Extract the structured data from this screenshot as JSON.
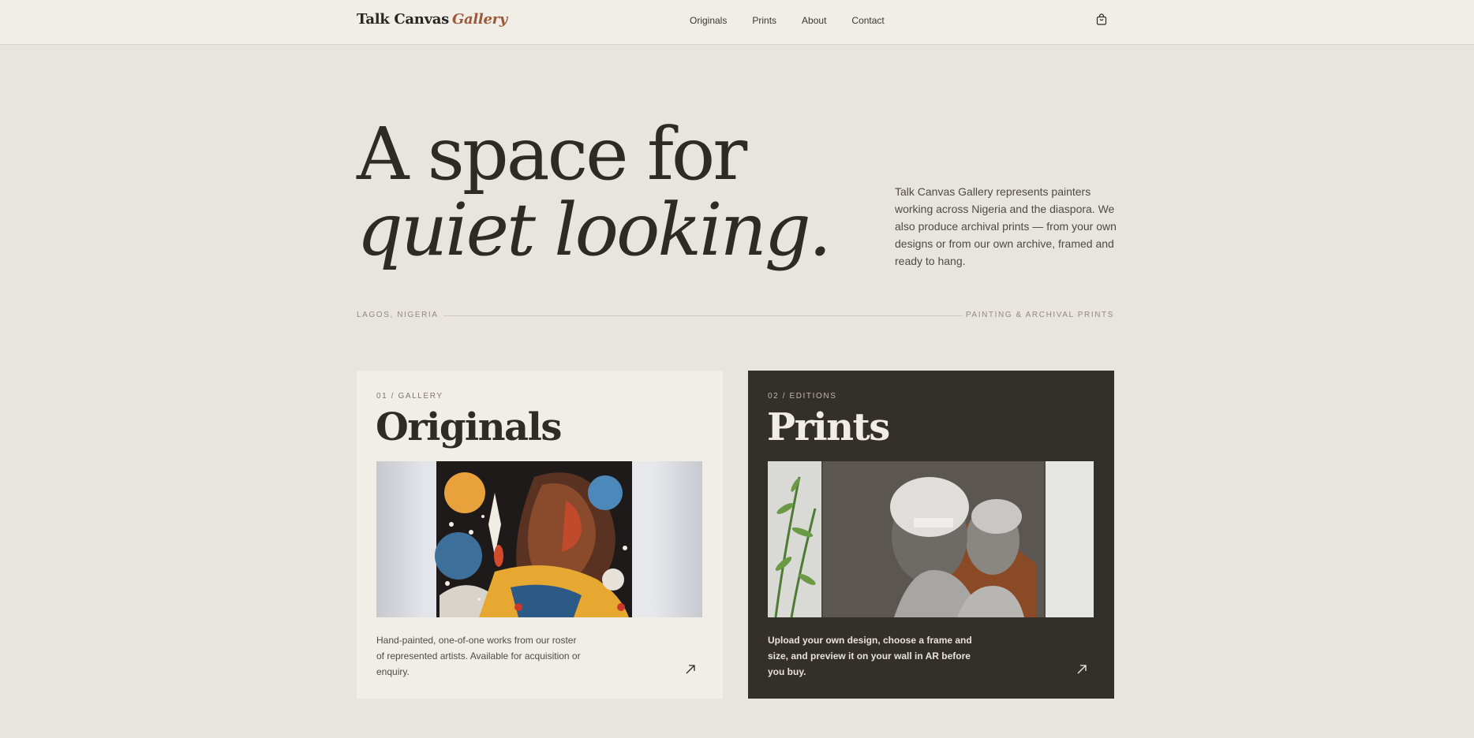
{
  "nav": {
    "brand_main": "Talk Canvas",
    "brand_accent": "Gallery",
    "links": [
      "Originals",
      "Prints",
      "About",
      "Contact"
    ],
    "cart_icon": "shopping-bag-icon"
  },
  "hero": {
    "line1": "A space for",
    "line2": "quiet looking.",
    "description": "Talk Canvas Gallery represents painters working across Nigeria and the diaspora. We also produce archival prints — from your own designs or from our own archive, framed and ready to hang.",
    "location": "LAGOS, NIGERIA",
    "tagline": "PAINTING & ARCHIVAL PRINTS"
  },
  "cards": [
    {
      "eyebrow": "01 / GALLERY",
      "title": "Originals",
      "text": "Hand-painted, one-of-one works from our roster of represented artists. Available for acquisition or enquiry.",
      "arrow_icon": "arrow-up-right-icon"
    },
    {
      "eyebrow": "02 / EDITIONS",
      "title": "Prints",
      "text": "Upload your own design, choose a frame and size, and preview it on your wall in AR before you buy.",
      "arrow_icon": "arrow-up-right-icon"
    }
  ],
  "colors": {
    "background": "#e8e4de",
    "nav_bg": "#f1eee8",
    "accent": "#9a5a3a",
    "dark_card": "#33302c"
  }
}
